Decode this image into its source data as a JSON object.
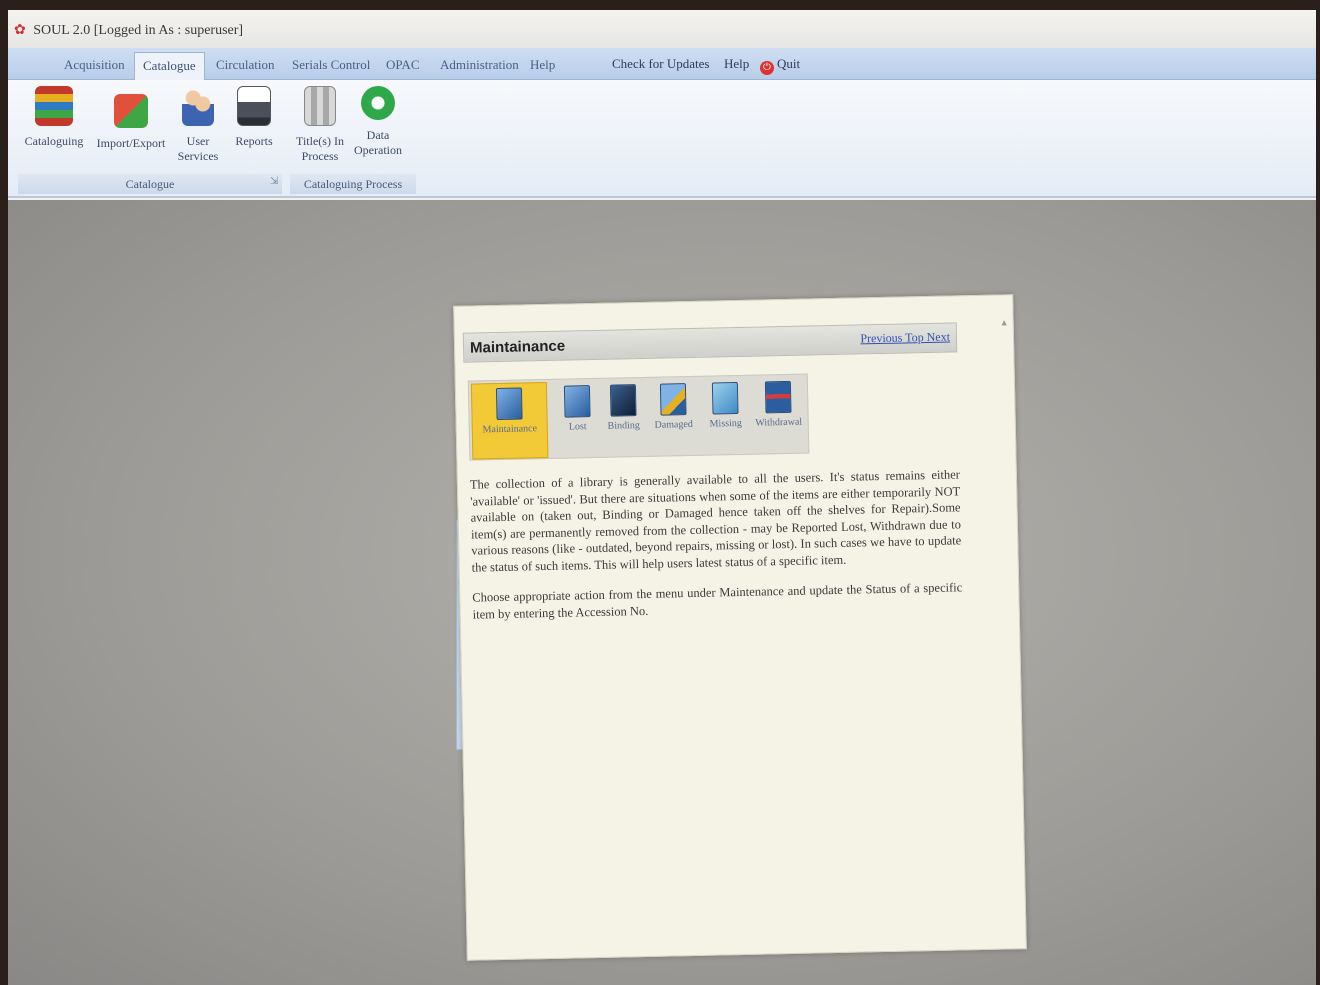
{
  "window": {
    "title": "SOUL 2.0  [Logged in As : superuser]"
  },
  "menu": {
    "tabs": [
      {
        "label": "Acquisition"
      },
      {
        "label": "Catalogue"
      },
      {
        "label": "Circulation"
      },
      {
        "label": "Serials Control"
      },
      {
        "label": "OPAC"
      },
      {
        "label": "Administration"
      },
      {
        "label": "Help"
      }
    ],
    "quick": [
      {
        "label": "Check for Updates"
      },
      {
        "label": "Help"
      },
      {
        "label": "Quit"
      }
    ]
  },
  "ribbon": {
    "buttons": [
      {
        "label": "Cataloguing",
        "icon": "books-icon"
      },
      {
        "label": "Import/Export",
        "icon": "import-export-icon"
      },
      {
        "label": "User Services",
        "icon": "users-icon"
      },
      {
        "label": "Reports",
        "icon": "printer-icon"
      },
      {
        "label": "Title(s) In Process",
        "icon": "title-process-icon"
      },
      {
        "label": "Data Operation",
        "icon": "data-operation-icon"
      }
    ],
    "groups": [
      {
        "label": "Catalogue"
      },
      {
        "label": "Cataloguing Process"
      }
    ]
  },
  "help_window": {
    "title": "Maintainance",
    "nav": "Previous  Top  Next",
    "icons": [
      {
        "label": "Maintainance",
        "selected": true
      },
      {
        "label": "Lost"
      },
      {
        "label": "Binding"
      },
      {
        "label": "Damaged"
      },
      {
        "label": "Missing"
      },
      {
        "label": "Withdrawal"
      }
    ],
    "paragraph1": "The collection of a library is generally available to all the users. It's status remains either 'available' or 'issued'. But there are situations when some of the items are either temporarily NOT available on (taken out, Binding or Damaged hence taken off the shelves for Repair).Some item(s) are permanently removed from the collection - may be Reported Lost, Withdrawn due to various reasons (like - outdated, beyond repairs, missing or lost). In such cases we have to update the status of such items. This will help users latest status of a specific item.",
    "paragraph2": "Choose appropriate action from the menu under Maintenance and update the Status of a specific item by entering the Accession No."
  },
  "colors": {
    "menubar": "#b7cde8",
    "help_background": "#f5f3e6",
    "selected_icon": "#f2c936",
    "link": "#3550b0"
  }
}
